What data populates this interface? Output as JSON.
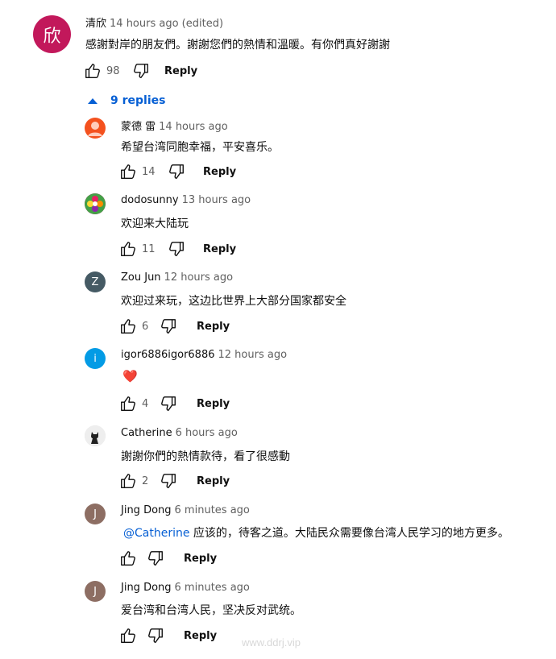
{
  "top_comment": {
    "avatar_letter": "欣",
    "avatar_color": "#c2185b",
    "author": "清欣",
    "time": "14 hours ago (edited)",
    "text": "感謝對岸的朋友們。謝謝您們的熱情和溫暖。有你們真好謝謝",
    "likes": "98",
    "reply_label": "Reply"
  },
  "replies_toggle": {
    "label": "9 replies"
  },
  "replies": [
    {
      "author": "蒙德 雷",
      "time": "14 hours ago",
      "text": "希望台湾同胞幸福，平安喜乐。",
      "likes": "14",
      "reply_label": "Reply",
      "avatar_letter": "",
      "avatar_color": "#f4511e"
    },
    {
      "author": "dodosunny",
      "time": "13 hours ago",
      "text": "欢迎来大陆玩",
      "likes": "11",
      "reply_label": "Reply",
      "avatar_letter": "",
      "avatar_color": "#ad1457"
    },
    {
      "author": "Zou Jun",
      "time": "12 hours ago",
      "text": "欢迎过来玩，这边比世界上大部分国家都安全",
      "likes": "6",
      "reply_label": "Reply",
      "avatar_letter": "Z",
      "avatar_color": "#455a64"
    },
    {
      "author": "igor6886igor6886",
      "time": "12 hours ago",
      "text": "❤️",
      "likes": "4",
      "reply_label": "Reply",
      "avatar_letter": "i",
      "avatar_color": "#039be5"
    },
    {
      "author": "Catherine",
      "time": "6 hours ago",
      "text": "謝謝你們的熱情款待，看了很感動",
      "likes": "2",
      "reply_label": "Reply",
      "avatar_letter": "",
      "avatar_color": "#e0e0e0"
    },
    {
      "author": "Jing Dong",
      "time": "6 minutes ago",
      "mention": "@Catherine",
      "text": "应该的，待客之道。大陆民众需要像台湾人民学习的地方更多。",
      "likes": "",
      "reply_label": "Reply",
      "avatar_letter": "J",
      "avatar_color": "#8d6e63"
    },
    {
      "author": "Jing Dong",
      "time": "6 minutes ago",
      "text": "爱台湾和台湾人民，坚决反对武统。",
      "likes": "",
      "reply_label": "Reply",
      "avatar_letter": "J",
      "avatar_color": "#8d6e63"
    }
  ],
  "watermark": "www.ddrj.vip"
}
